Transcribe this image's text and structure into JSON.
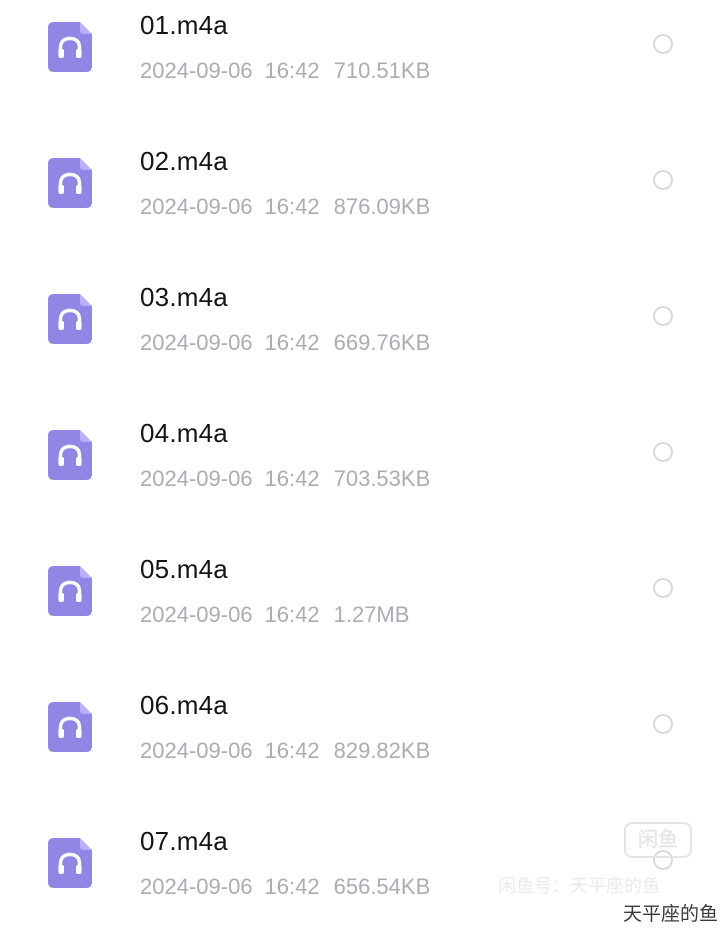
{
  "colors": {
    "icon_fill": "#8f86e6",
    "icon_fold": "#b8b2f2",
    "name_text": "#151515",
    "meta_text": "#a9adb4",
    "radio_border": "#d9dbe0"
  },
  "files": [
    {
      "name": "01.m4a",
      "date": "2024-09-06",
      "time": "16:42",
      "size": "710.51KB",
      "icon": "audio-file-icon",
      "selected": false
    },
    {
      "name": "02.m4a",
      "date": "2024-09-06",
      "time": "16:42",
      "size": "876.09KB",
      "icon": "audio-file-icon",
      "selected": false
    },
    {
      "name": "03.m4a",
      "date": "2024-09-06",
      "time": "16:42",
      "size": "669.76KB",
      "icon": "audio-file-icon",
      "selected": false
    },
    {
      "name": "04.m4a",
      "date": "2024-09-06",
      "time": "16:42",
      "size": "703.53KB",
      "icon": "audio-file-icon",
      "selected": false
    },
    {
      "name": "05.m4a",
      "date": "2024-09-06",
      "time": "16:42",
      "size": "1.27MB",
      "icon": "audio-file-icon",
      "selected": false
    },
    {
      "name": "06.m4a",
      "date": "2024-09-06",
      "time": "16:42",
      "size": "829.82KB",
      "icon": "audio-file-icon",
      "selected": false
    },
    {
      "name": "07.m4a",
      "date": "2024-09-06",
      "time": "16:42",
      "size": "656.54KB",
      "icon": "audio-file-icon",
      "selected": false
    }
  ],
  "watermark": {
    "logo_text": "闲鱼",
    "line_text": "闲鱼号：天平座的鱼",
    "author_text": "天平座的鱼"
  }
}
